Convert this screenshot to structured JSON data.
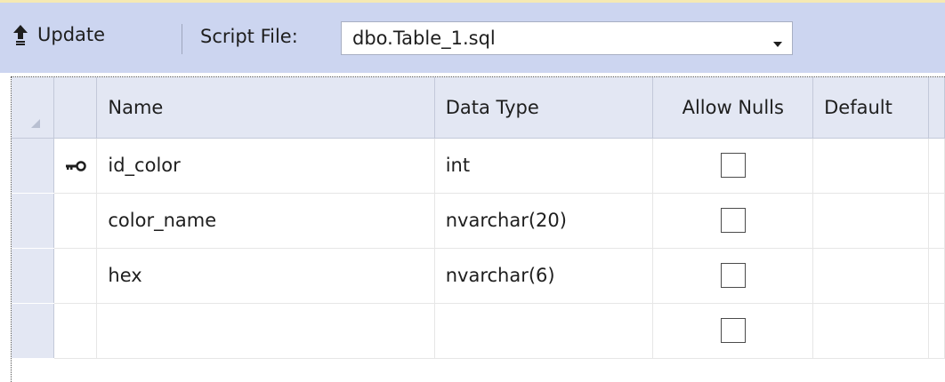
{
  "toolbar": {
    "update_label": "Update",
    "script_file_label": "Script File:",
    "script_file_value": "dbo.Table_1.sql"
  },
  "grid": {
    "columns": [
      "Name",
      "Data Type",
      "Allow Nulls",
      "Default"
    ],
    "rows": [
      {
        "name": "id_color",
        "data_type": "int",
        "allow_nulls": false,
        "primary_key": true
      },
      {
        "name": "color_name",
        "data_type": "nvarchar(20)",
        "allow_nulls": false,
        "primary_key": false
      },
      {
        "name": "hex",
        "data_type": "nvarchar(6)",
        "allow_nulls": false,
        "primary_key": false
      },
      {
        "name": "",
        "data_type": "",
        "allow_nulls": false,
        "primary_key": false
      }
    ]
  },
  "icons": {
    "update": "arrow-up-icon",
    "primary_key": "key-icon",
    "dropdown": "chevron-down-icon"
  },
  "colors": {
    "toolbar_bg": "#ccd5f0",
    "header_bg": "#e3e7f3",
    "top_accent": "#f5e9b3"
  }
}
